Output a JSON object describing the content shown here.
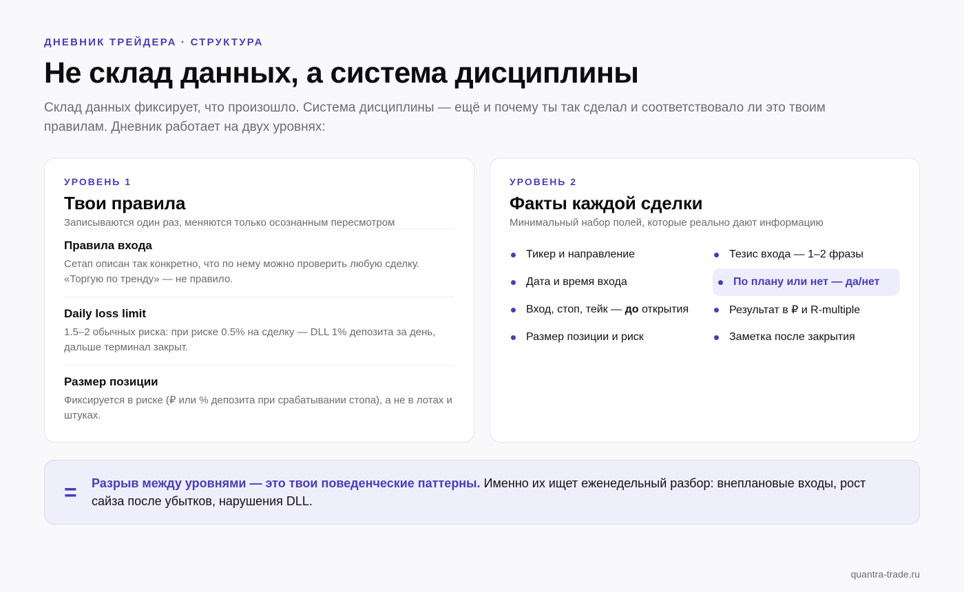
{
  "header": {
    "eyebrow": "ДНЕВНИК ТРЕЙДЕРА · СТРУКТУРА",
    "title": "Не склад данных, а система дисциплины",
    "lede": "Склад данных фиксирует, что произошло. Система дисциплины — ещё и почему ты так сделал и соответствовало ли это твоим правилам. Дневник работает на двух уровнях:"
  },
  "level1": {
    "label": "УРОВЕНЬ 1",
    "title": "Твои правила",
    "subtitle": "Записываются один раз, меняются только осознанным пересмотром",
    "rules": [
      {
        "title": "Правила входа",
        "text": "Сетап описан так конкретно, что по нему можно проверить любую сделку. «Торгую по тренду» — не правило."
      },
      {
        "title": "Daily loss limit",
        "text": "1.5–2 обычных риска: при риске 0.5% на сделку — DLL 1% депозита за день, дальше терминал закрыт."
      },
      {
        "title": "Размер позиции",
        "text": "Фиксируется в риске (₽ или % депозита при срабатывании стопа), а не в лотах и штуках."
      }
    ]
  },
  "level2": {
    "label": "УРОВЕНЬ 2",
    "title": "Факты каждой сделки",
    "subtitle": "Минимальный набор полей, которые реально дают информацию",
    "fields": {
      "f1": "Тикер и направление",
      "f2": "Тезис входа — 1–2 фразы",
      "f3": "Дата и время входа",
      "f4": "По плану или нет — да/нет",
      "f5_pre": "Вход, стоп, тейк — ",
      "f5_bold": "до",
      "f5_post": " открытия",
      "f6": "Результат в ₽ и R-multiple",
      "f7": "Размер позиции и риск",
      "f8": "Заметка после закрытия"
    }
  },
  "callout": {
    "symbol": "=",
    "strong": "Разрыв между уровнями — это твои поведенческие паттерны.",
    "rest": " Именно их ищет еженедельный разбор: внеплановые входы, рост сайза после убытков, нарушения DLL."
  },
  "footer": {
    "site": "quantra-trade.ru"
  },
  "colors": {
    "accent": "#4a3db8",
    "highlight_bg": "#eeedfb",
    "callout_bg": "#efeefb"
  }
}
